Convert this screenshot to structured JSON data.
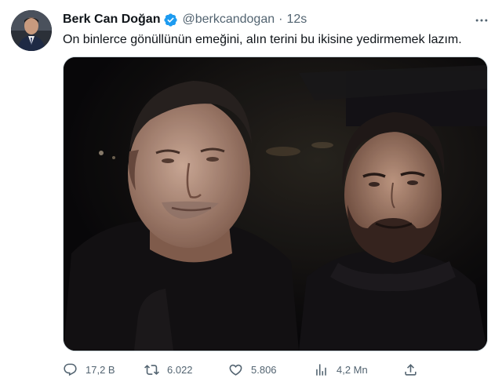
{
  "tweet": {
    "author": {
      "display_name": "Berk Can Doğan",
      "handle": "@berkcandogan",
      "verified": true,
      "avatar_icon": "profile-photo"
    },
    "separator": "·",
    "time": "12s",
    "text": "On binlerce gönüllünün emeğini, alın terini bu ikisine yedirmemek lazım.",
    "media": {
      "kind": "photo",
      "icon": "photo-two-men-night"
    },
    "actions": {
      "replies": "17,2 B",
      "retweets": "6.022",
      "likes": "5.806",
      "views": "4,2 Mn"
    }
  },
  "colors": {
    "text": "#0f1419",
    "secondary": "#536471",
    "verified_blue": "#1d9bf0",
    "border": "#cfd9de"
  }
}
